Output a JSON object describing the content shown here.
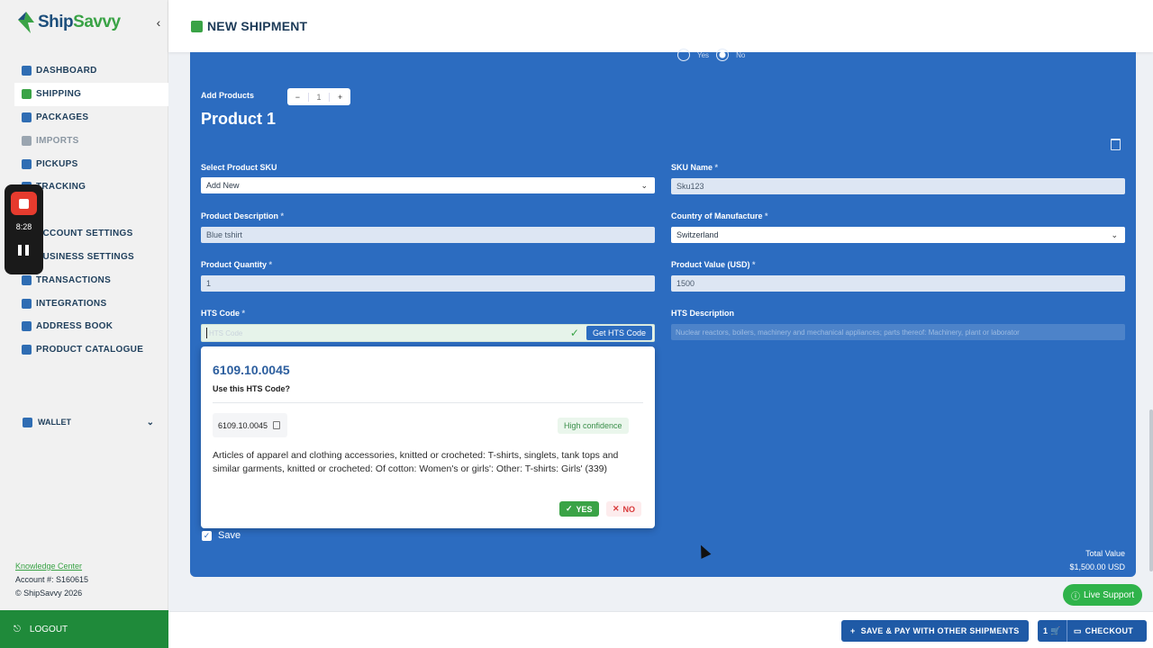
{
  "brand": {
    "name_part1": "Ship",
    "name_part2": "Savvy",
    "primary": "#2c6cc0",
    "accent": "#3aa346"
  },
  "sidebar": {
    "items": [
      {
        "label": "DASHBOARD",
        "icon": "home-icon"
      },
      {
        "label": "SHIPPING",
        "icon": "box-icon",
        "active": true
      },
      {
        "label": "PACKAGES",
        "icon": "package-icon"
      },
      {
        "label": "IMPORTS",
        "icon": "import-icon",
        "disabled": true
      },
      {
        "label": "PICKUPS",
        "icon": "truck-icon"
      },
      {
        "label": "TRACKING",
        "icon": "tracking-icon"
      },
      {
        "label": "ACCOUNT SETTINGS",
        "icon": "user-icon"
      },
      {
        "label": "BUSINESS SETTINGS",
        "icon": "briefcase-icon"
      },
      {
        "label": "TRANSACTIONS",
        "icon": "receipt-icon"
      },
      {
        "label": "INTEGRATIONS",
        "icon": "plug-icon"
      },
      {
        "label": "ADDRESS BOOK",
        "icon": "book-icon"
      },
      {
        "label": "PRODUCT CATALOGUE",
        "icon": "catalogue-icon"
      }
    ],
    "wallet_label": "WALLET",
    "footer": {
      "knowledge_center": "Knowledge Center",
      "account": "Account #: S160615",
      "copyright": "© ShipSavvy 2026"
    },
    "logout_label": "LOGOUT"
  },
  "recorder": {
    "time": "8:28"
  },
  "header": {
    "title": "NEW SHIPMENT"
  },
  "form": {
    "radio_yes": "Yes",
    "radio_no": "No",
    "add_products_label": "Add Products",
    "product_count": "1",
    "product_title": "Product 1",
    "sku_select_label": "Select Product SKU",
    "sku_select_value": "Add New",
    "sku_name_label": "SKU Name",
    "sku_name_value": "Sku123",
    "description_label": "Product Description",
    "description_value": "Blue tshirt",
    "country_label": "Country of Manufacture",
    "country_value": "Switzerland",
    "quantity_label": "Product Quantity",
    "quantity_value": "1",
    "value_label": "Product Value (USD)",
    "value_value": "1500",
    "hts_label": "HTS Code",
    "hts_placeholder": "HTS Code",
    "get_hts_label": "Get HTS Code",
    "hts_desc_label": "HTS Description",
    "hts_desc_value": "Nuclear reactors, boilers, machinery and mechanical appliances; parts thereof: Machinery, plant or laborator",
    "save_label": "Save",
    "total_label": "Total Value",
    "total_value": "$1,500.00 USD"
  },
  "hts_popup": {
    "code": "6109.10.0045",
    "question": "Use this HTS Code?",
    "chip_code": "6109.10.0045",
    "confidence": "High confidence",
    "description": "Articles of apparel and clothing accessories, knitted or crocheted: T-shirts, singlets, tank tops and similar garments, knitted or crocheted: Of cotton: Women's or girls': Other: T-shirts: Girls' (339)",
    "yes_label": "YES",
    "no_label": "NO"
  },
  "live_support_label": "Live Support",
  "bottom": {
    "save_pay_label": "SAVE & PAY WITH OTHER SHIPMENTS",
    "cart_count": "1",
    "checkout_label": "CHECKOUT"
  }
}
